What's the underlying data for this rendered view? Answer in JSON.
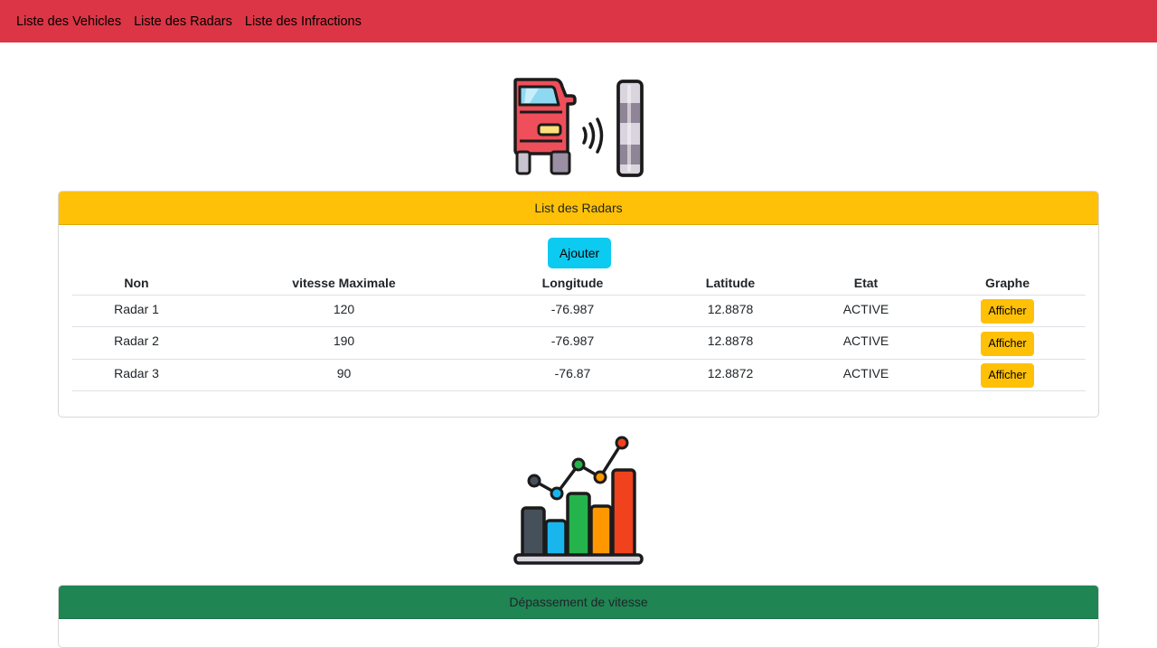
{
  "nav": {
    "items": [
      "Liste des Vehicles",
      "Liste des Radars",
      "Liste des Infractions"
    ]
  },
  "icons": {
    "hero": "car-radar-icon",
    "chart": "bar-line-chart-icon"
  },
  "colors": {
    "navbar": "#dc3545",
    "radars_header": "#ffc107",
    "speed_header": "#1f8553",
    "add_button": "#0dcaf0",
    "show_button": "#ffc107"
  },
  "radars_card": {
    "title": "List des Radars",
    "add_label": "Ajouter",
    "columns": [
      "Non",
      "vitesse Maximale",
      "Longitude",
      "Latitude",
      "Etat",
      "Graphe"
    ],
    "rows": [
      {
        "name": "Radar 1",
        "max_speed": "120",
        "longitude": "-76.987",
        "latitude": "12.8878",
        "state": "ACTIVE",
        "action": "Afficher"
      },
      {
        "name": "Radar 2",
        "max_speed": "190",
        "longitude": "-76.987",
        "latitude": "12.8878",
        "state": "ACTIVE",
        "action": "Afficher"
      },
      {
        "name": "Radar 3",
        "max_speed": "90",
        "longitude": "-76.87",
        "latitude": "12.8872",
        "state": "ACTIVE",
        "action": "Afficher"
      }
    ]
  },
  "speed_card": {
    "title": "Dépassement de vitesse"
  }
}
